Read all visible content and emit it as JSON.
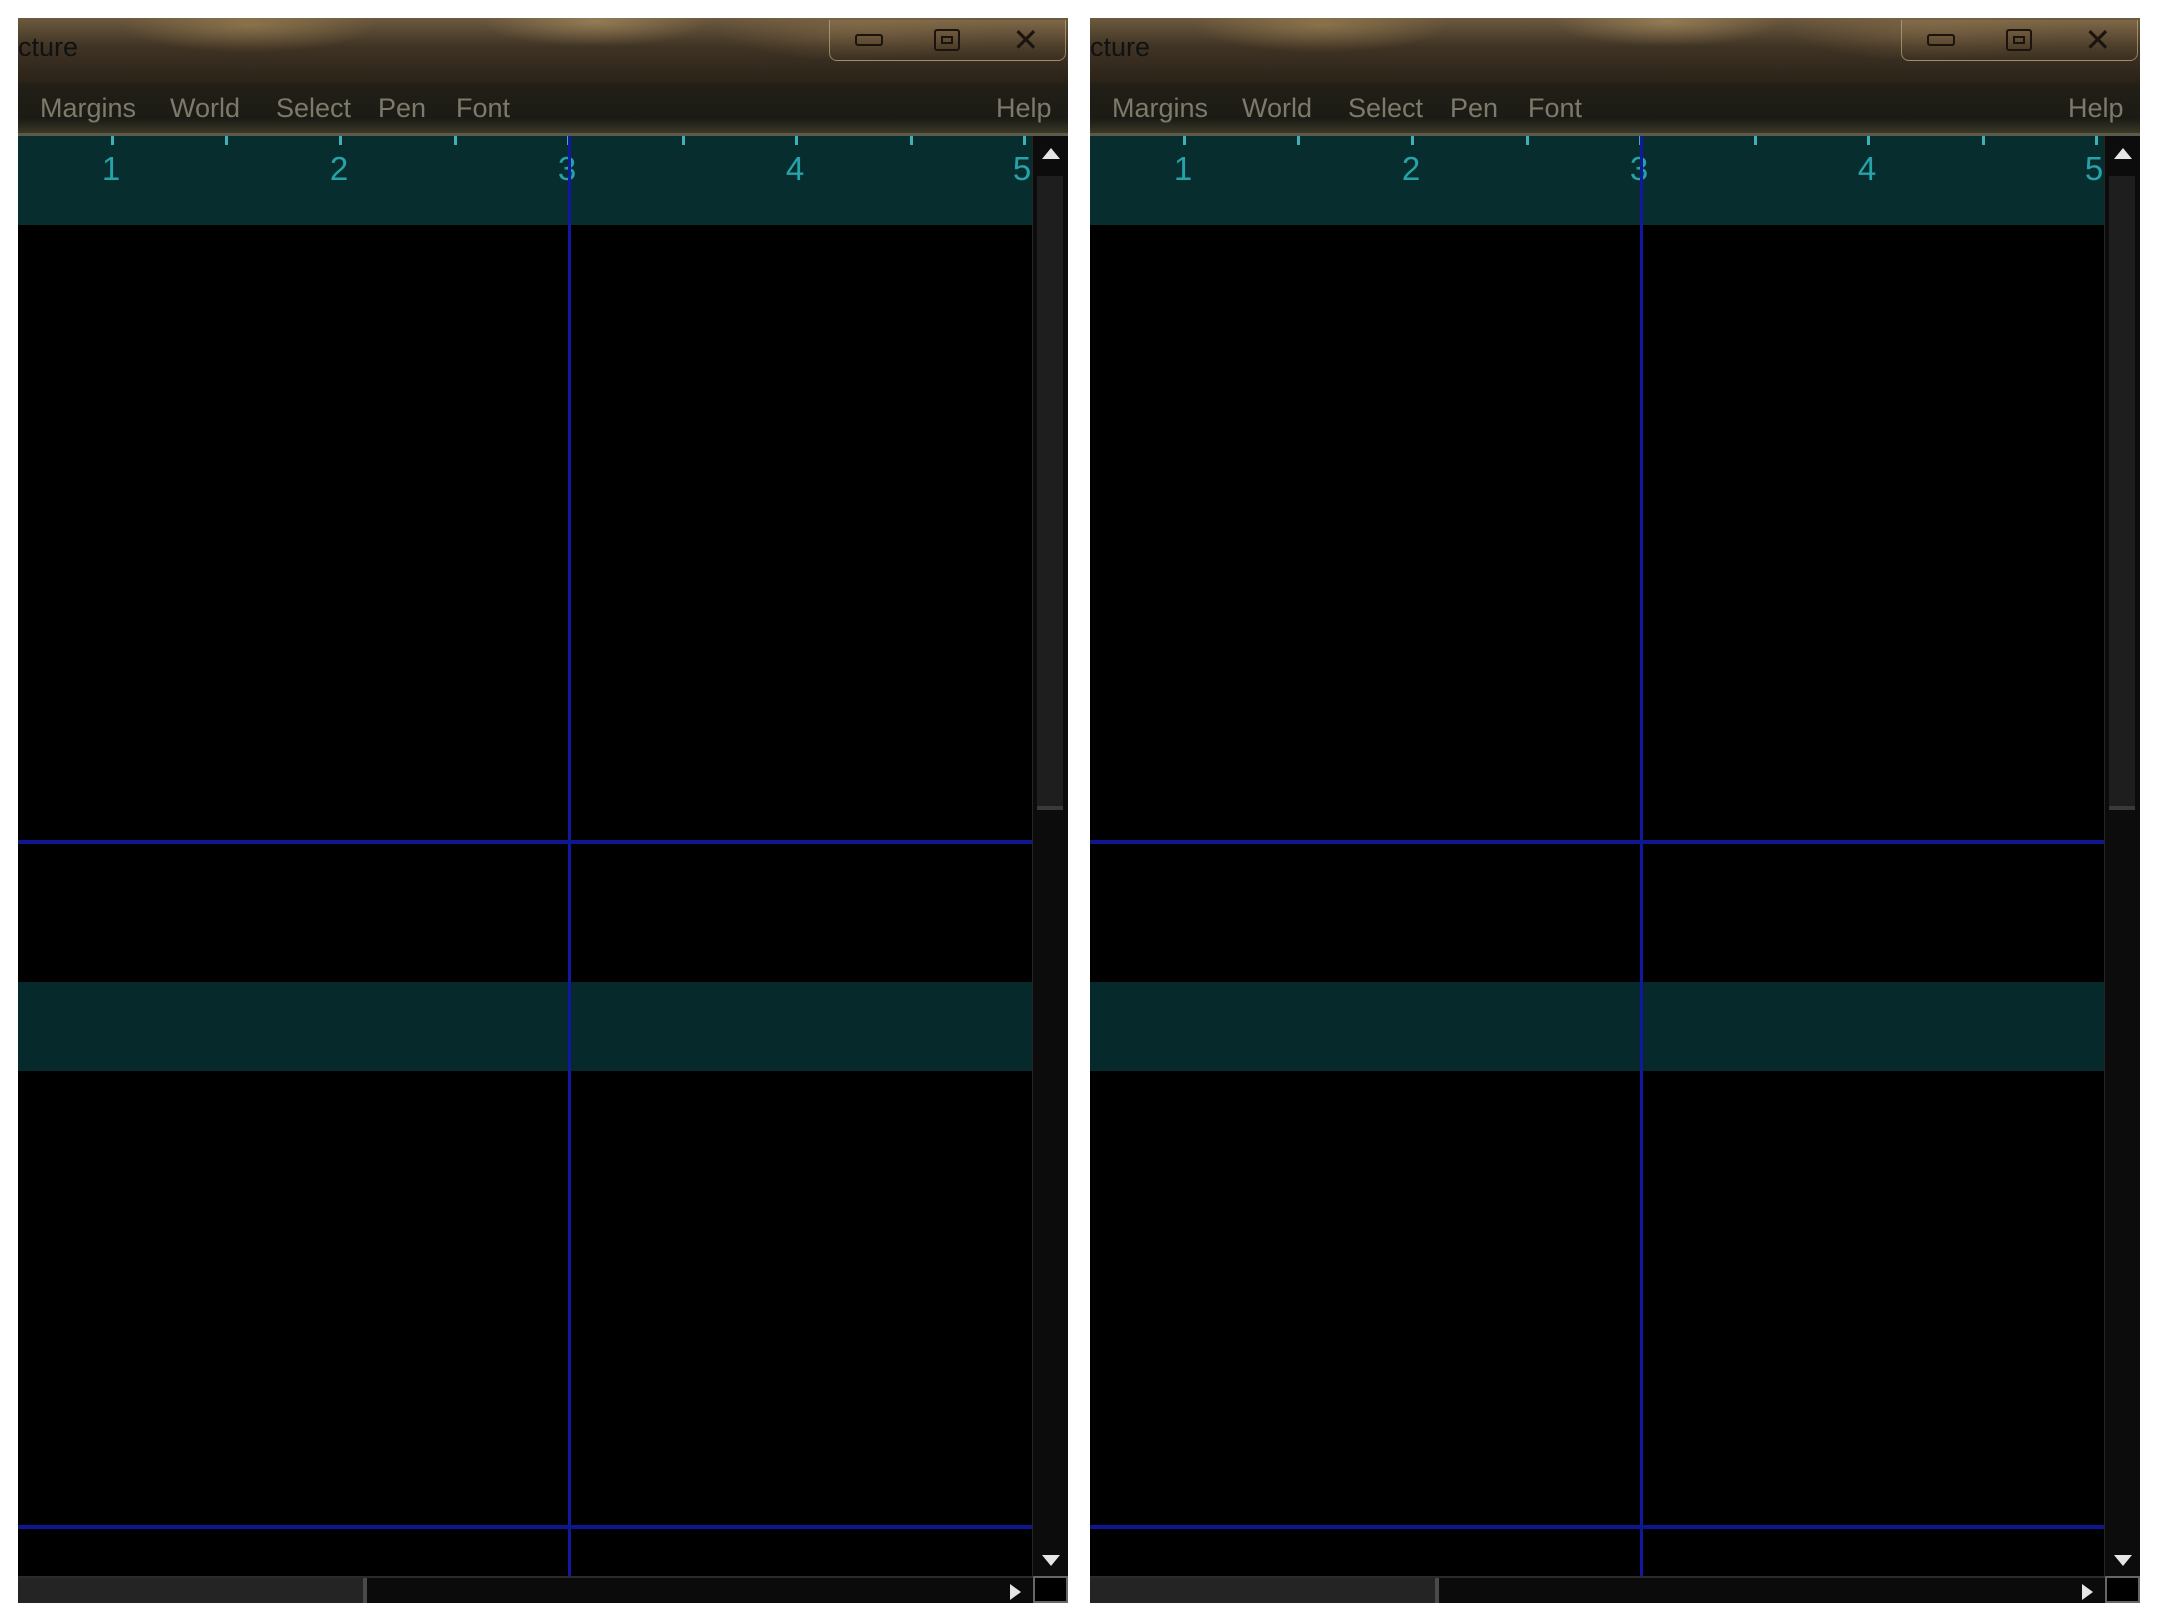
{
  "windows": [
    {
      "title": "cture",
      "menu": {
        "items": [
          "Margins",
          "World",
          "Select",
          "Pen",
          "Font"
        ],
        "help": "Help"
      },
      "ruler": {
        "labels": [
          "1",
          "2",
          "3",
          "4",
          "5"
        ]
      }
    },
    {
      "title": "cture",
      "menu": {
        "items": [
          "Margins",
          "World",
          "Select",
          "Pen",
          "Font"
        ],
        "help": "Help"
      },
      "ruler": {
        "labels": [
          "1",
          "2",
          "3",
          "4",
          "5"
        ]
      }
    }
  ],
  "colors": {
    "band": "#072d2e",
    "guide_line": "#1018a0",
    "ruler_text": "#25a3a9",
    "menu_text": "#7d7a6d"
  },
  "icons": [
    "minimize-icon",
    "maximize-icon",
    "close-icon",
    "scroll-up-arrow-icon",
    "scroll-down-arrow-icon",
    "scroll-right-arrow-icon"
  ]
}
